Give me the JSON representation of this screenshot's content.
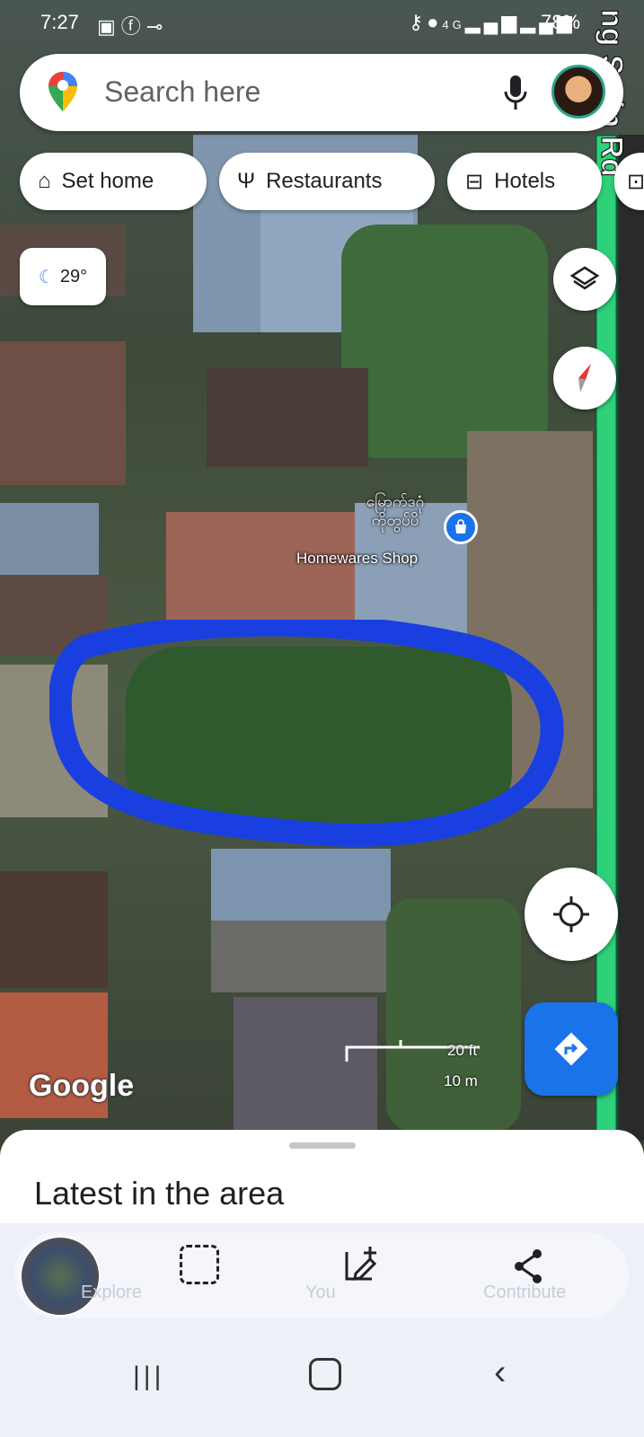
{
  "status_bar": {
    "time": "7:27",
    "left_icons": [
      "gallery-icon",
      "facebook-icon",
      "key-icon"
    ],
    "network": "4G",
    "battery": "78%"
  },
  "search": {
    "placeholder": "Search here"
  },
  "chips": [
    {
      "label": "Set home",
      "icon": "home-icon"
    },
    {
      "label": "Restaurants",
      "icon": "restaurant-icon"
    },
    {
      "label": "Hotels",
      "icon": "hotel-icon"
    }
  ],
  "weather": {
    "temperature": "29°",
    "icon": "moon-cloud-icon"
  },
  "map": {
    "road_label": "ng S  ain Rd",
    "poi": {
      "name_local": "မြောက်ဒဂုံ\nကိုတွပ်ပိ",
      "name": "Homewares Shop",
      "icon": "shopping-bag-icon"
    },
    "scale_ft": "20 ft",
    "scale_m": "10 m",
    "attribution": "Google",
    "highlight_color": "#1a3fe0",
    "road_color": "#2fd07a"
  },
  "sheet": {
    "title": "Latest in the area"
  },
  "bottom_nav": {
    "items": [
      {
        "label": "Explore"
      },
      {
        "label": "You"
      },
      {
        "label": "Contribute"
      }
    ]
  },
  "colors": {
    "accent_blue": "#1a73e8"
  }
}
